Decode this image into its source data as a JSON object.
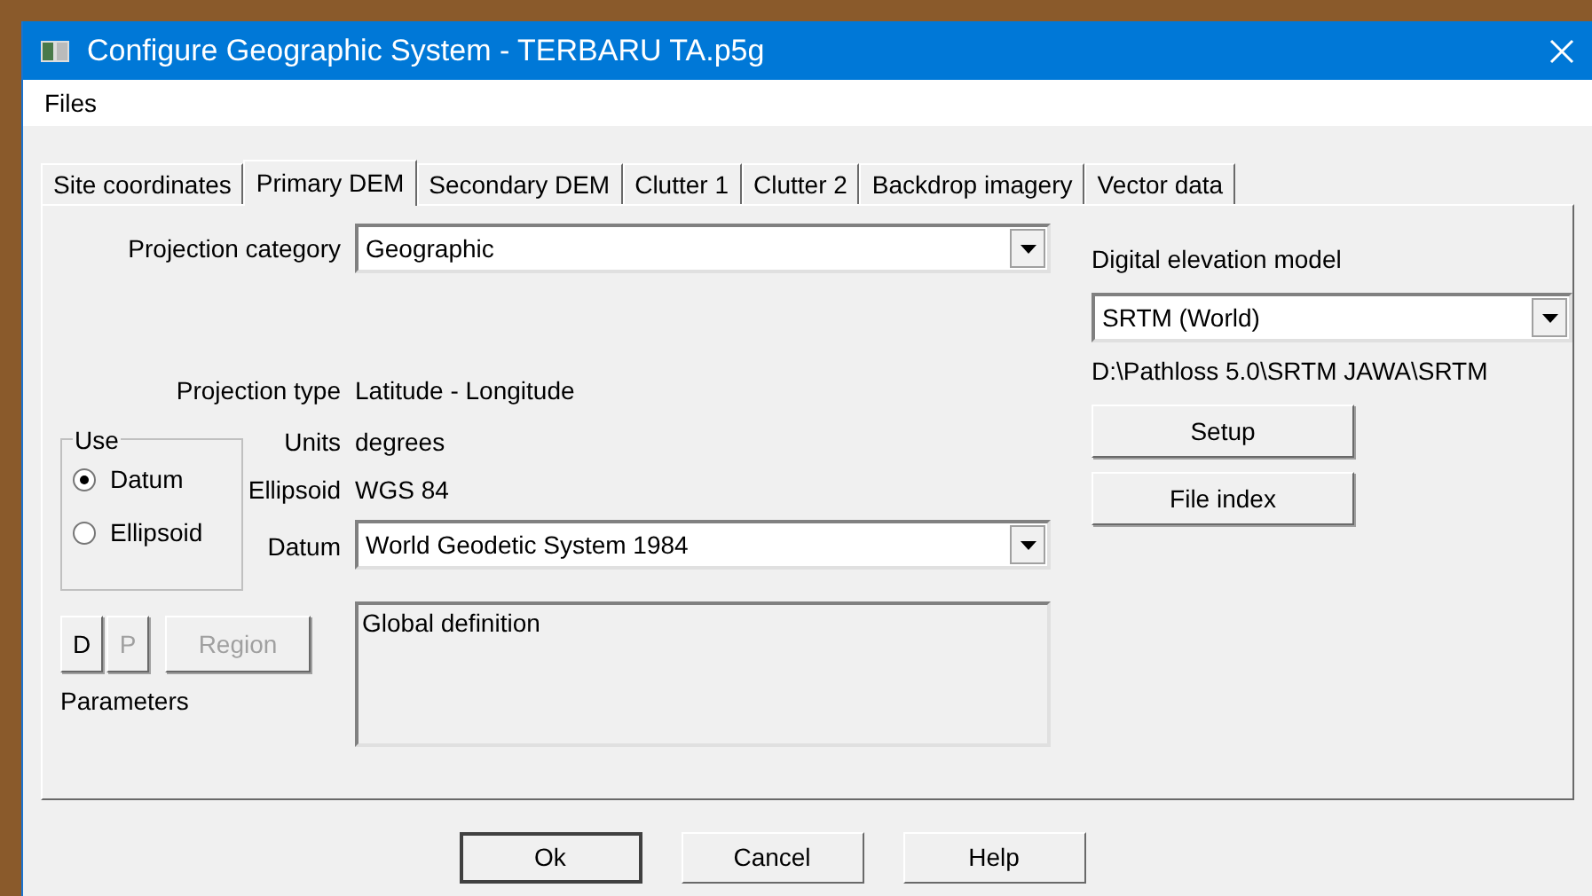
{
  "window": {
    "title": "Configure Geographic System - TERBARU TA.p5g"
  },
  "menu": [
    "Files"
  ],
  "tabs": [
    {
      "label": "Site coordinates",
      "selected": false
    },
    {
      "label": "Primary DEM",
      "selected": true
    },
    {
      "label": "Secondary DEM",
      "selected": false
    },
    {
      "label": "Clutter 1",
      "selected": false
    },
    {
      "label": "Clutter 2",
      "selected": false
    },
    {
      "label": "Backdrop imagery",
      "selected": false
    },
    {
      "label": "Vector data",
      "selected": false
    }
  ],
  "projection_category": {
    "label": "Projection category",
    "value": "Geographic"
  },
  "projection_type": {
    "label": "Projection type",
    "value": "Latitude - Longitude"
  },
  "units": {
    "label": "Units",
    "value": "degrees"
  },
  "ellipsoid": {
    "label": "Ellipsoid",
    "value": "WGS 84"
  },
  "datum": {
    "label": "Datum",
    "value": "World Geodetic System 1984"
  },
  "use_group": {
    "title": "Use",
    "options": [
      {
        "label": "Datum",
        "selected": true
      },
      {
        "label": "Ellipsoid",
        "selected": false
      }
    ]
  },
  "parameter_buttons": [
    {
      "label": "D",
      "disabled": false
    },
    {
      "label": "P",
      "disabled": true
    },
    {
      "label": "Region",
      "disabled": true
    }
  ],
  "parameters_label": "Parameters",
  "description": "Global definition",
  "dem": {
    "label": "Digital elevation model",
    "value": "SRTM (World)",
    "path": "D:\\Pathloss 5.0\\SRTM JAWA\\SRTM",
    "buttons": [
      "Setup",
      "File index"
    ]
  },
  "buttons": [
    {
      "label": "Ok",
      "default": true
    },
    {
      "label": "Cancel",
      "default": false
    },
    {
      "label": "Help",
      "default": false
    }
  ]
}
